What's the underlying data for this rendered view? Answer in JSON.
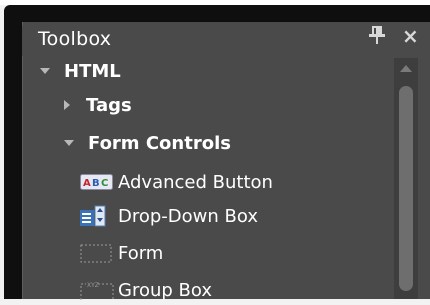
{
  "panel": {
    "title": "Toolbox",
    "pin_icon": "pin-icon",
    "close_icon": "close-icon",
    "close_glyph": "×"
  },
  "tree": {
    "html": {
      "label": "HTML",
      "expanded": true
    },
    "tags": {
      "label": "Tags",
      "expanded": false
    },
    "form_controls": {
      "label": "Form Controls",
      "expanded": true
    },
    "items": [
      {
        "label": "Advanced Button",
        "icon": "abc-button-icon"
      },
      {
        "label": "Drop-Down Box",
        "icon": "dropdown-list-icon"
      },
      {
        "label": "Form",
        "icon": "form-outline-icon"
      },
      {
        "label": "Group Box",
        "icon": "group-box-icon"
      }
    ]
  },
  "colors": {
    "panel_bg": "#4a4a4a",
    "frame_bg": "#0f0f0f",
    "text": "#ffffff",
    "scroll_thumb": "#6e6e6e"
  }
}
